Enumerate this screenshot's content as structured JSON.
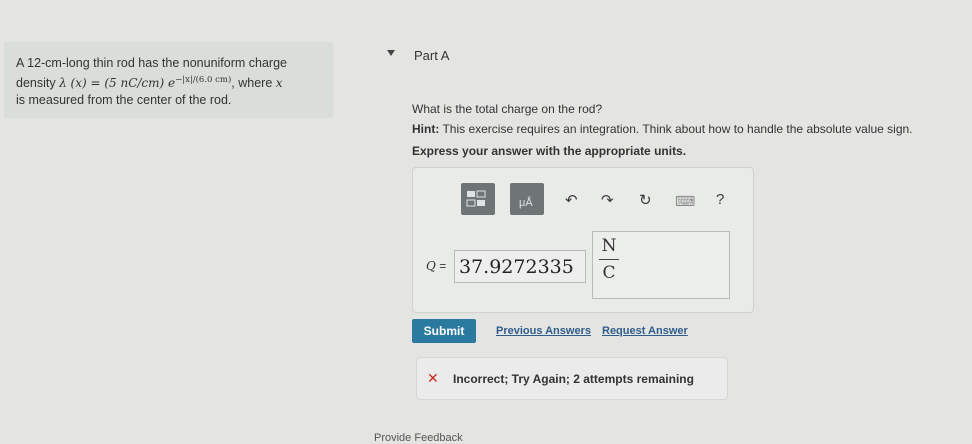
{
  "problem": {
    "line1": "A 12-cm-long thin rod has the nonuniform charge",
    "density_prefix": "density ",
    "density_math": "λ (x) = (5 nC/cm) e",
    "exponent": "−|x|/(6.0 cm)",
    "where": ", where",
    "x_var": "x",
    "line3": "is measured from the center of the rod."
  },
  "part": {
    "title": "Part A"
  },
  "question": {
    "text": "What is the total charge on the rod?",
    "hint_label": "Hint:",
    "hint_text": " This exercise requires an integration. Think about how to handle the absolute value sign.",
    "instruction": "Express your answer with the appropriate units."
  },
  "toolbar": {
    "templates_icon": "templates-icon",
    "units_icon": "units-icon",
    "units_glyph": "μÅ",
    "undo_glyph": "↶",
    "redo_glyph": "↷",
    "reset_glyph": "↻",
    "keyboard_glyph": "⌨",
    "help_glyph": "?"
  },
  "answer": {
    "label": "Q",
    "equals": "=",
    "value": "37.9272335",
    "unit_numerator": "N",
    "unit_denominator": "C"
  },
  "actions": {
    "submit": "Submit",
    "previous_answers": "Previous Answers",
    "request_answer": "Request Answer"
  },
  "feedback": {
    "icon": "✕",
    "text": "Incorrect; Try Again; 2 attempts remaining"
  },
  "footer": {
    "provide_feedback": "Provide Feedback"
  },
  "colors": {
    "submit": "#2a7aa0",
    "error": "#c42b1c",
    "link": "#2f5c8a"
  }
}
